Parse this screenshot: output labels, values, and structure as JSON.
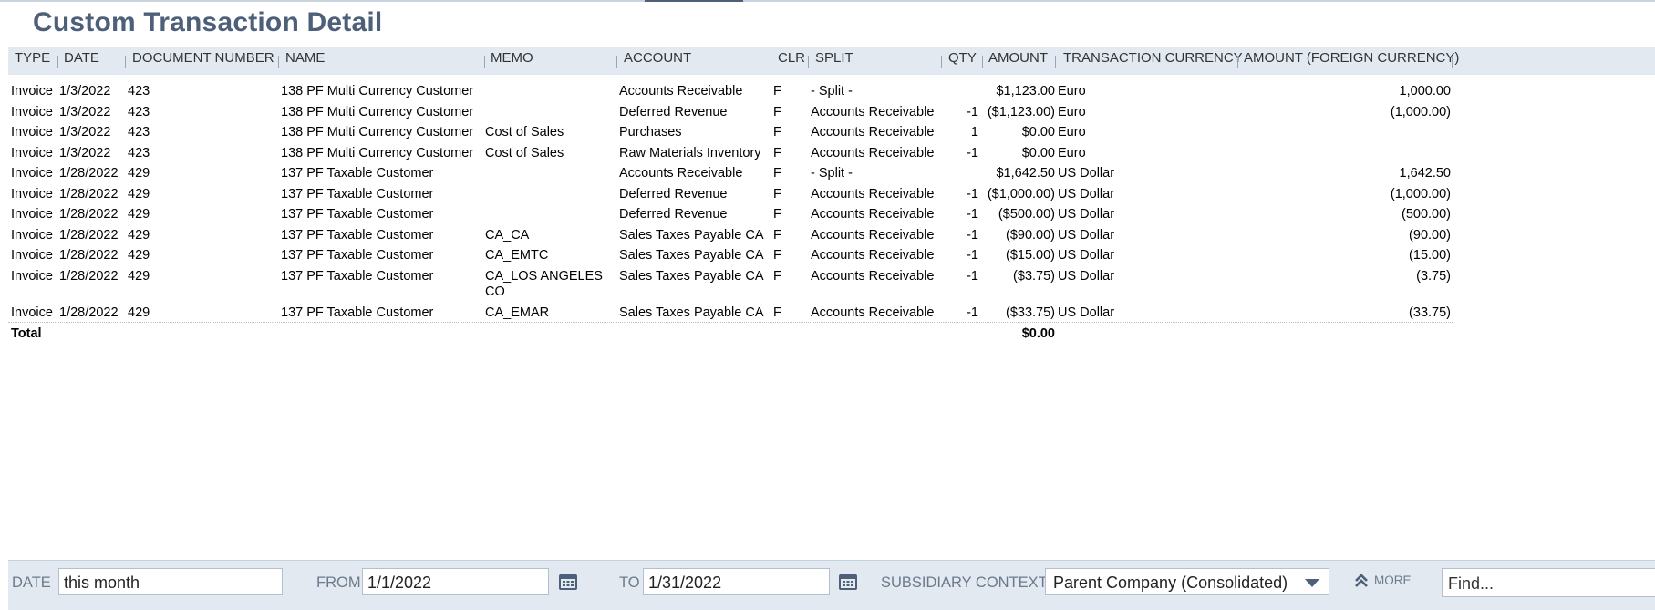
{
  "page": {
    "title": "Custom Transaction Detail"
  },
  "table": {
    "headers": [
      "TYPE",
      "DATE",
      "DOCUMENT NUMBER",
      "NAME",
      "MEMO",
      "ACCOUNT",
      "CLR",
      "SPLIT",
      "QTY",
      "AMOUNT",
      "TRANSACTION CURRENCY",
      "AMOUNT (FOREIGN CURRENCY)"
    ],
    "rows": [
      [
        "Invoice",
        "1/3/2022",
        "423",
        "138 PF Multi Currency Customer",
        "",
        "Accounts Receivable",
        "F",
        "- Split -",
        "",
        "$1,123.00",
        "Euro",
        "1,000.00"
      ],
      [
        "Invoice",
        "1/3/2022",
        "423",
        "138 PF Multi Currency Customer",
        "",
        "Deferred Revenue",
        "F",
        "Accounts Receivable",
        "-1",
        "($1,123.00)",
        "Euro",
        "(1,000.00)"
      ],
      [
        "Invoice",
        "1/3/2022",
        "423",
        "138 PF Multi Currency Customer",
        "Cost of Sales",
        "Purchases",
        "F",
        "Accounts Receivable",
        "1",
        "$0.00",
        "Euro",
        ""
      ],
      [
        "Invoice",
        "1/3/2022",
        "423",
        "138 PF Multi Currency Customer",
        "Cost of Sales",
        "Raw Materials Inventory",
        "F",
        "Accounts Receivable",
        "-1",
        "$0.00",
        "Euro",
        ""
      ],
      [
        "Invoice",
        "1/28/2022",
        "429",
        "137 PF Taxable Customer",
        "",
        "Accounts Receivable",
        "F",
        "- Split -",
        "",
        "$1,642.50",
        "US Dollar",
        "1,642.50"
      ],
      [
        "Invoice",
        "1/28/2022",
        "429",
        "137 PF Taxable Customer",
        "",
        "Deferred Revenue",
        "F",
        "Accounts Receivable",
        "-1",
        "($1,000.00)",
        "US Dollar",
        "(1,000.00)"
      ],
      [
        "Invoice",
        "1/28/2022",
        "429",
        "137 PF Taxable Customer",
        "",
        "Deferred Revenue",
        "F",
        "Accounts Receivable",
        "-1",
        "($500.00)",
        "US Dollar",
        "(500.00)"
      ],
      [
        "Invoice",
        "1/28/2022",
        "429",
        "137 PF Taxable Customer",
        "CA_CA",
        "Sales Taxes Payable CA",
        "F",
        "Accounts Receivable",
        "-1",
        "($90.00)",
        "US Dollar",
        "(90.00)"
      ],
      [
        "Invoice",
        "1/28/2022",
        "429",
        "137 PF Taxable Customer",
        "CA_EMTC",
        "Sales Taxes Payable CA",
        "F",
        "Accounts Receivable",
        "-1",
        "($15.00)",
        "US Dollar",
        "(15.00)"
      ],
      [
        "Invoice",
        "1/28/2022",
        "429",
        "137 PF Taxable Customer",
        "CA_LOS ANGELES CO",
        "Sales Taxes Payable CA",
        "F",
        "Accounts Receivable",
        "-1",
        "($3.75)",
        "US Dollar",
        "(3.75)"
      ],
      [
        "Invoice",
        "1/28/2022",
        "429",
        "137 PF Taxable Customer",
        "CA_EMAR",
        "Sales Taxes Payable CA",
        "F",
        "Accounts Receivable",
        "-1",
        "($33.75)",
        "US Dollar",
        "(33.75)"
      ]
    ],
    "total": {
      "label": "Total",
      "amount": "$0.00"
    }
  },
  "filters": {
    "date_label": "DATE",
    "date_value": "this month",
    "from_label": "FROM",
    "from_value": "1/1/2022",
    "to_label": "TO",
    "to_value": "1/31/2022",
    "subsidiary_label": "SUBSIDIARY CONTEXT",
    "subsidiary_value": "Parent Company (Consolidated)",
    "more_label": "MORE",
    "find_placeholder": "Find..."
  },
  "icons": {
    "calendar": "calendar-icon",
    "more": "double-chevron-up-icon",
    "dropdown": "caret-down-icon"
  },
  "colors": {
    "title": "#4d5f79",
    "header_bg": "#e2e9f1",
    "label": "#6b7a8c"
  }
}
